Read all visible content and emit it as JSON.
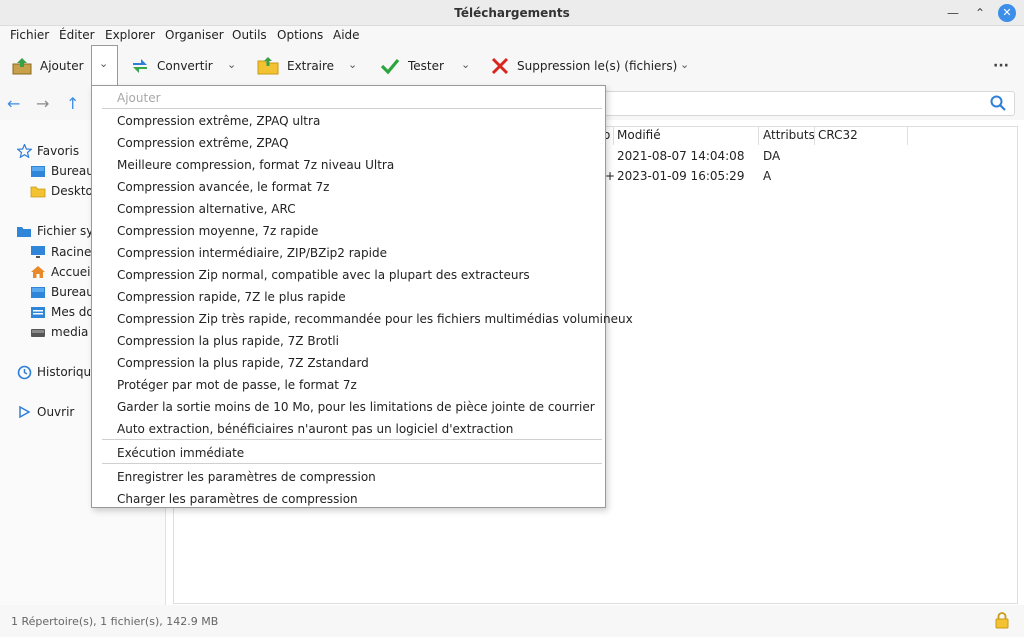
{
  "window": {
    "title": "Téléchargements"
  },
  "menubar": [
    "Fichier",
    "Éditer",
    "Explorer",
    "Organiser",
    "Outils",
    "Options",
    "Aide"
  ],
  "toolbar": {
    "add_label": "Ajouter",
    "convert_label": "Convertir",
    "extract_label": "Extraire",
    "test_label": "Tester",
    "delete_label": "Suppression le(s) (fichiers)",
    "more_label": "···"
  },
  "dropdown": {
    "header": "Ajouter",
    "items": [
      "Compression extrême, ZPAQ ultra",
      "Compression extrême, ZPAQ",
      "Meilleure compression, format 7z niveau Ultra",
      "Compression avancée, le format 7z",
      "Compression alternative, ARC",
      "Compression moyenne, 7z rapide",
      "Compression intermédiaire, ZIP/BZip2 rapide",
      "Compression Zip normal, compatible avec la plupart des extracteurs",
      "Compression rapide, 7Z le plus rapide",
      "Compression Zip très rapide, recommandée pour les fichiers multimédias volumineux",
      "Compression la plus rapide, 7Z Brotli",
      "Compression la plus rapide, 7Z Zstandard",
      "Protéger par mot de passe, le format 7z",
      "Garder la sortie moins de 10 Mo, pour les limitations de pièce jointe de courrier",
      "Auto extraction, bénéficiaires n'auront pas un logiciel d'extraction"
    ],
    "immediate": "Exécution immédiate",
    "save_params": "Enregistrer les paramètres de compression",
    "load_params": "Charger les paramètres de compression"
  },
  "sidebar": {
    "favorites": "Favoris",
    "fav_items": [
      "Bureau",
      "Desktop"
    ],
    "filesystem": "Fichier sys",
    "fs_items": [
      "Racine d",
      "Accueil",
      "Bureau",
      "Mes doc",
      "media"
    ],
    "history": "Historique",
    "open": "Ouvrir"
  },
  "table": {
    "columns": [
      "o",
      "Modifié",
      "Attributs",
      "CRC32"
    ],
    "rows": [
      {
        "prefix": "",
        "modified": "2021-08-07 14:04:08",
        "attrs": "DA"
      },
      {
        "prefix": "+",
        "modified": "2023-01-09 16:05:29",
        "attrs": "A"
      }
    ]
  },
  "status": {
    "text": "1 Répertoire(s), 1 fichier(s), 142.9 MB"
  }
}
